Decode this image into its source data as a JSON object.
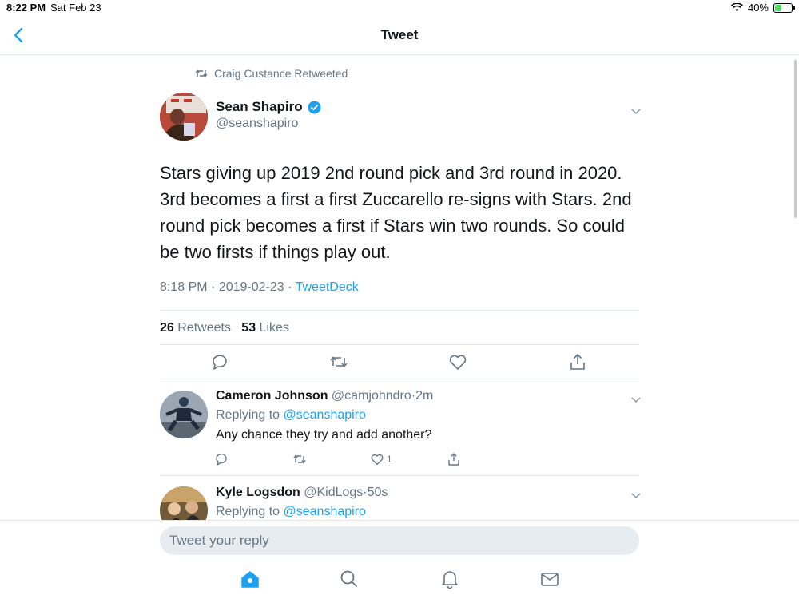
{
  "status": {
    "time": "8:22 PM",
    "date": "Sat Feb 23",
    "battery": "40%"
  },
  "nav": {
    "title": "Tweet",
    "back_icon": "chevron-left-icon"
  },
  "retweet_notice": "Craig Custance Retweeted",
  "tweet": {
    "name": "Sean Shapiro",
    "handle": "@seanshapiro",
    "verified": true,
    "text": "Stars giving up 2019 2nd round pick and 3rd round in 2020. 3rd becomes a first a first Zuccarello re-signs with Stars. 2nd round pick becomes a first if Stars win two rounds. So could be two firsts if things play out.",
    "time": "8:18 PM",
    "date": "2019-02-23",
    "source": "TweetDeck",
    "retweets_count": "26",
    "retweets_label": "Retweets",
    "likes_count": "53",
    "likes_label": "Likes"
  },
  "replies": [
    {
      "name": "Cameron Johnson",
      "handle": "@camjohndro",
      "time": "2m",
      "replying_prefix": "Replying to",
      "replying_to": "@seanshapiro",
      "text": "Any chance they try and add another?",
      "likes": "1"
    },
    {
      "name": "Kyle Logsdon",
      "handle": "@KidLogs",
      "time": "50s",
      "replying_prefix": "Replying to",
      "replying_to": "@seanshapiro"
    }
  ],
  "separator": "·",
  "reply_box": {
    "placeholder": "Tweet your reply"
  },
  "colors": {
    "accent": "#1da1f2",
    "text": "#14171a",
    "secondary": "#657786",
    "border": "#e1e8ed"
  }
}
